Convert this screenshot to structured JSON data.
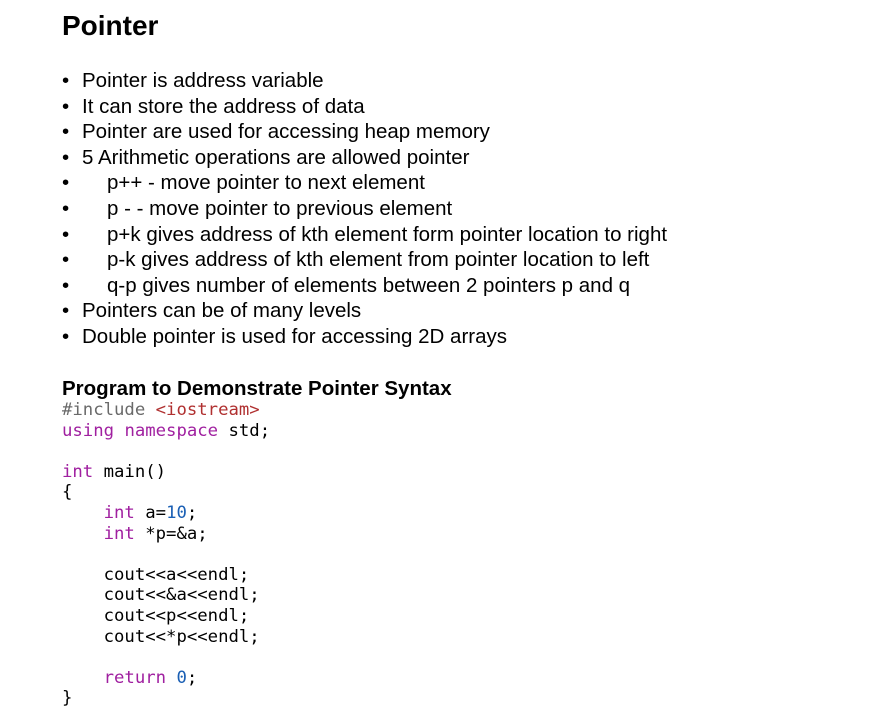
{
  "title": "Pointer",
  "bullets": [
    {
      "text": "Pointer is address variable",
      "sub": false
    },
    {
      "text": "It can store the address of data",
      "sub": false
    },
    {
      "text": "Pointer are used for accessing heap memory",
      "sub": false
    },
    {
      "text": "5 Arithmetic operations are allowed pointer",
      "sub": false
    },
    {
      "text": "p++ - move pointer to next element",
      "sub": true
    },
    {
      "text": "p - - move pointer to previous element",
      "sub": true
    },
    {
      "text": "p+k  gives address of kth element form pointer location to right",
      "sub": true
    },
    {
      "text": "p-k  gives address of kth element from pointer location to left",
      "sub": true
    },
    {
      "text": "q-p  gives number of elements between 2 pointers p and q",
      "sub": true
    },
    {
      "text": "Pointers can be of many levels",
      "sub": false
    },
    {
      "text": "Double pointer is used for accessing 2D arrays",
      "sub": false
    }
  ],
  "bullet_char": "•",
  "program_heading": "Program to Demonstrate Pointer Syntax",
  "code": {
    "include_directive": "#include",
    "include_header": "<iostream>",
    "using": "using",
    "namespace": "namespace",
    "std": " std;",
    "int_kw": "int",
    "main_sig": " main()",
    "open_brace": "{",
    "indent": "    ",
    "decl_a_name": " a=",
    "decl_a_value": "10",
    "semicolon": ";",
    "decl_p": " *p=&a;",
    "cout_1": "cout<<a<<endl;",
    "cout_2": "cout<<&a<<endl;",
    "cout_3": "cout<<p<<endl;",
    "cout_4": "cout<<*p<<endl;",
    "return_kw": "return",
    "return_value": "0",
    "close_brace": "}"
  },
  "colors": {
    "keyword": "#a020a0",
    "preprocessor": "#6a6a6a",
    "include_header": "#b03030",
    "number": "#1a5fb4"
  }
}
